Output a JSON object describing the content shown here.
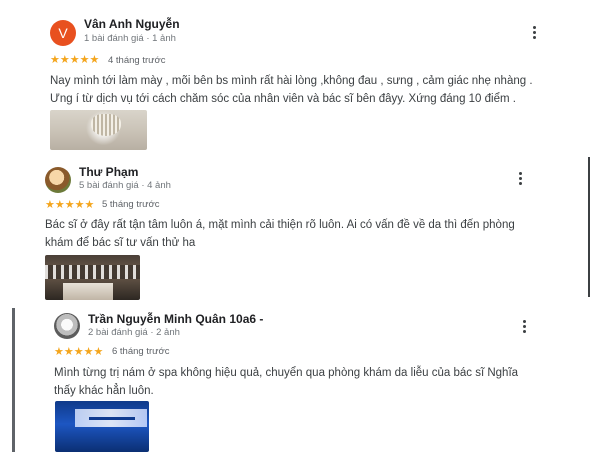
{
  "reviews": [
    {
      "avatar_letter": "V",
      "name": "Vân Anh Nguyễn",
      "meta": "1 bài đánh giá · 1 ảnh",
      "rating": 5,
      "stars": "★★★★★",
      "when": "4 tháng trước",
      "text": "Nay mình tới làm mày , mõi bên bs mình rất hài lòng ,không đau , sưng , cảm giác nhẹ nhàng . Ưng í từ dịch vụ tới cách chăm sóc của nhân viên và bác sĩ bên đâyy. Xứng đáng 10 điểm .",
      "more_icon": "more-vert-icon"
    },
    {
      "avatar_letter": "",
      "name": "Thư Phạm",
      "meta": "5 bài đánh giá · 4 ảnh",
      "rating": 5,
      "stars": "★★★★★",
      "when": "5 tháng trước",
      "text": "Bác sĩ ở đây rất tận tâm luôn á, mặt mình cải thiện rõ luôn. Ai có vấn đề về da thì đến phòng khám để bác sĩ tư vấn thử ha",
      "more_icon": "more-vert-icon"
    },
    {
      "avatar_letter": "",
      "name": "Trần Nguyễn Minh Quân 10a6 -",
      "meta": "2 bài đánh giá · 2 ảnh",
      "rating": 5,
      "stars": "★★★★★",
      "when": "6 tháng trước",
      "text": "Mình từng trị nám ở spa không hiệu quả, chuyển qua phòng khám da liễu của bác sĩ Nghĩa thấy khác hẳn luôn.",
      "more_icon": "more-vert-icon"
    }
  ],
  "colors": {
    "star": "#f4a51c",
    "avatar_v": "#e8501f",
    "name": "#202124",
    "meta": "#70757a"
  }
}
